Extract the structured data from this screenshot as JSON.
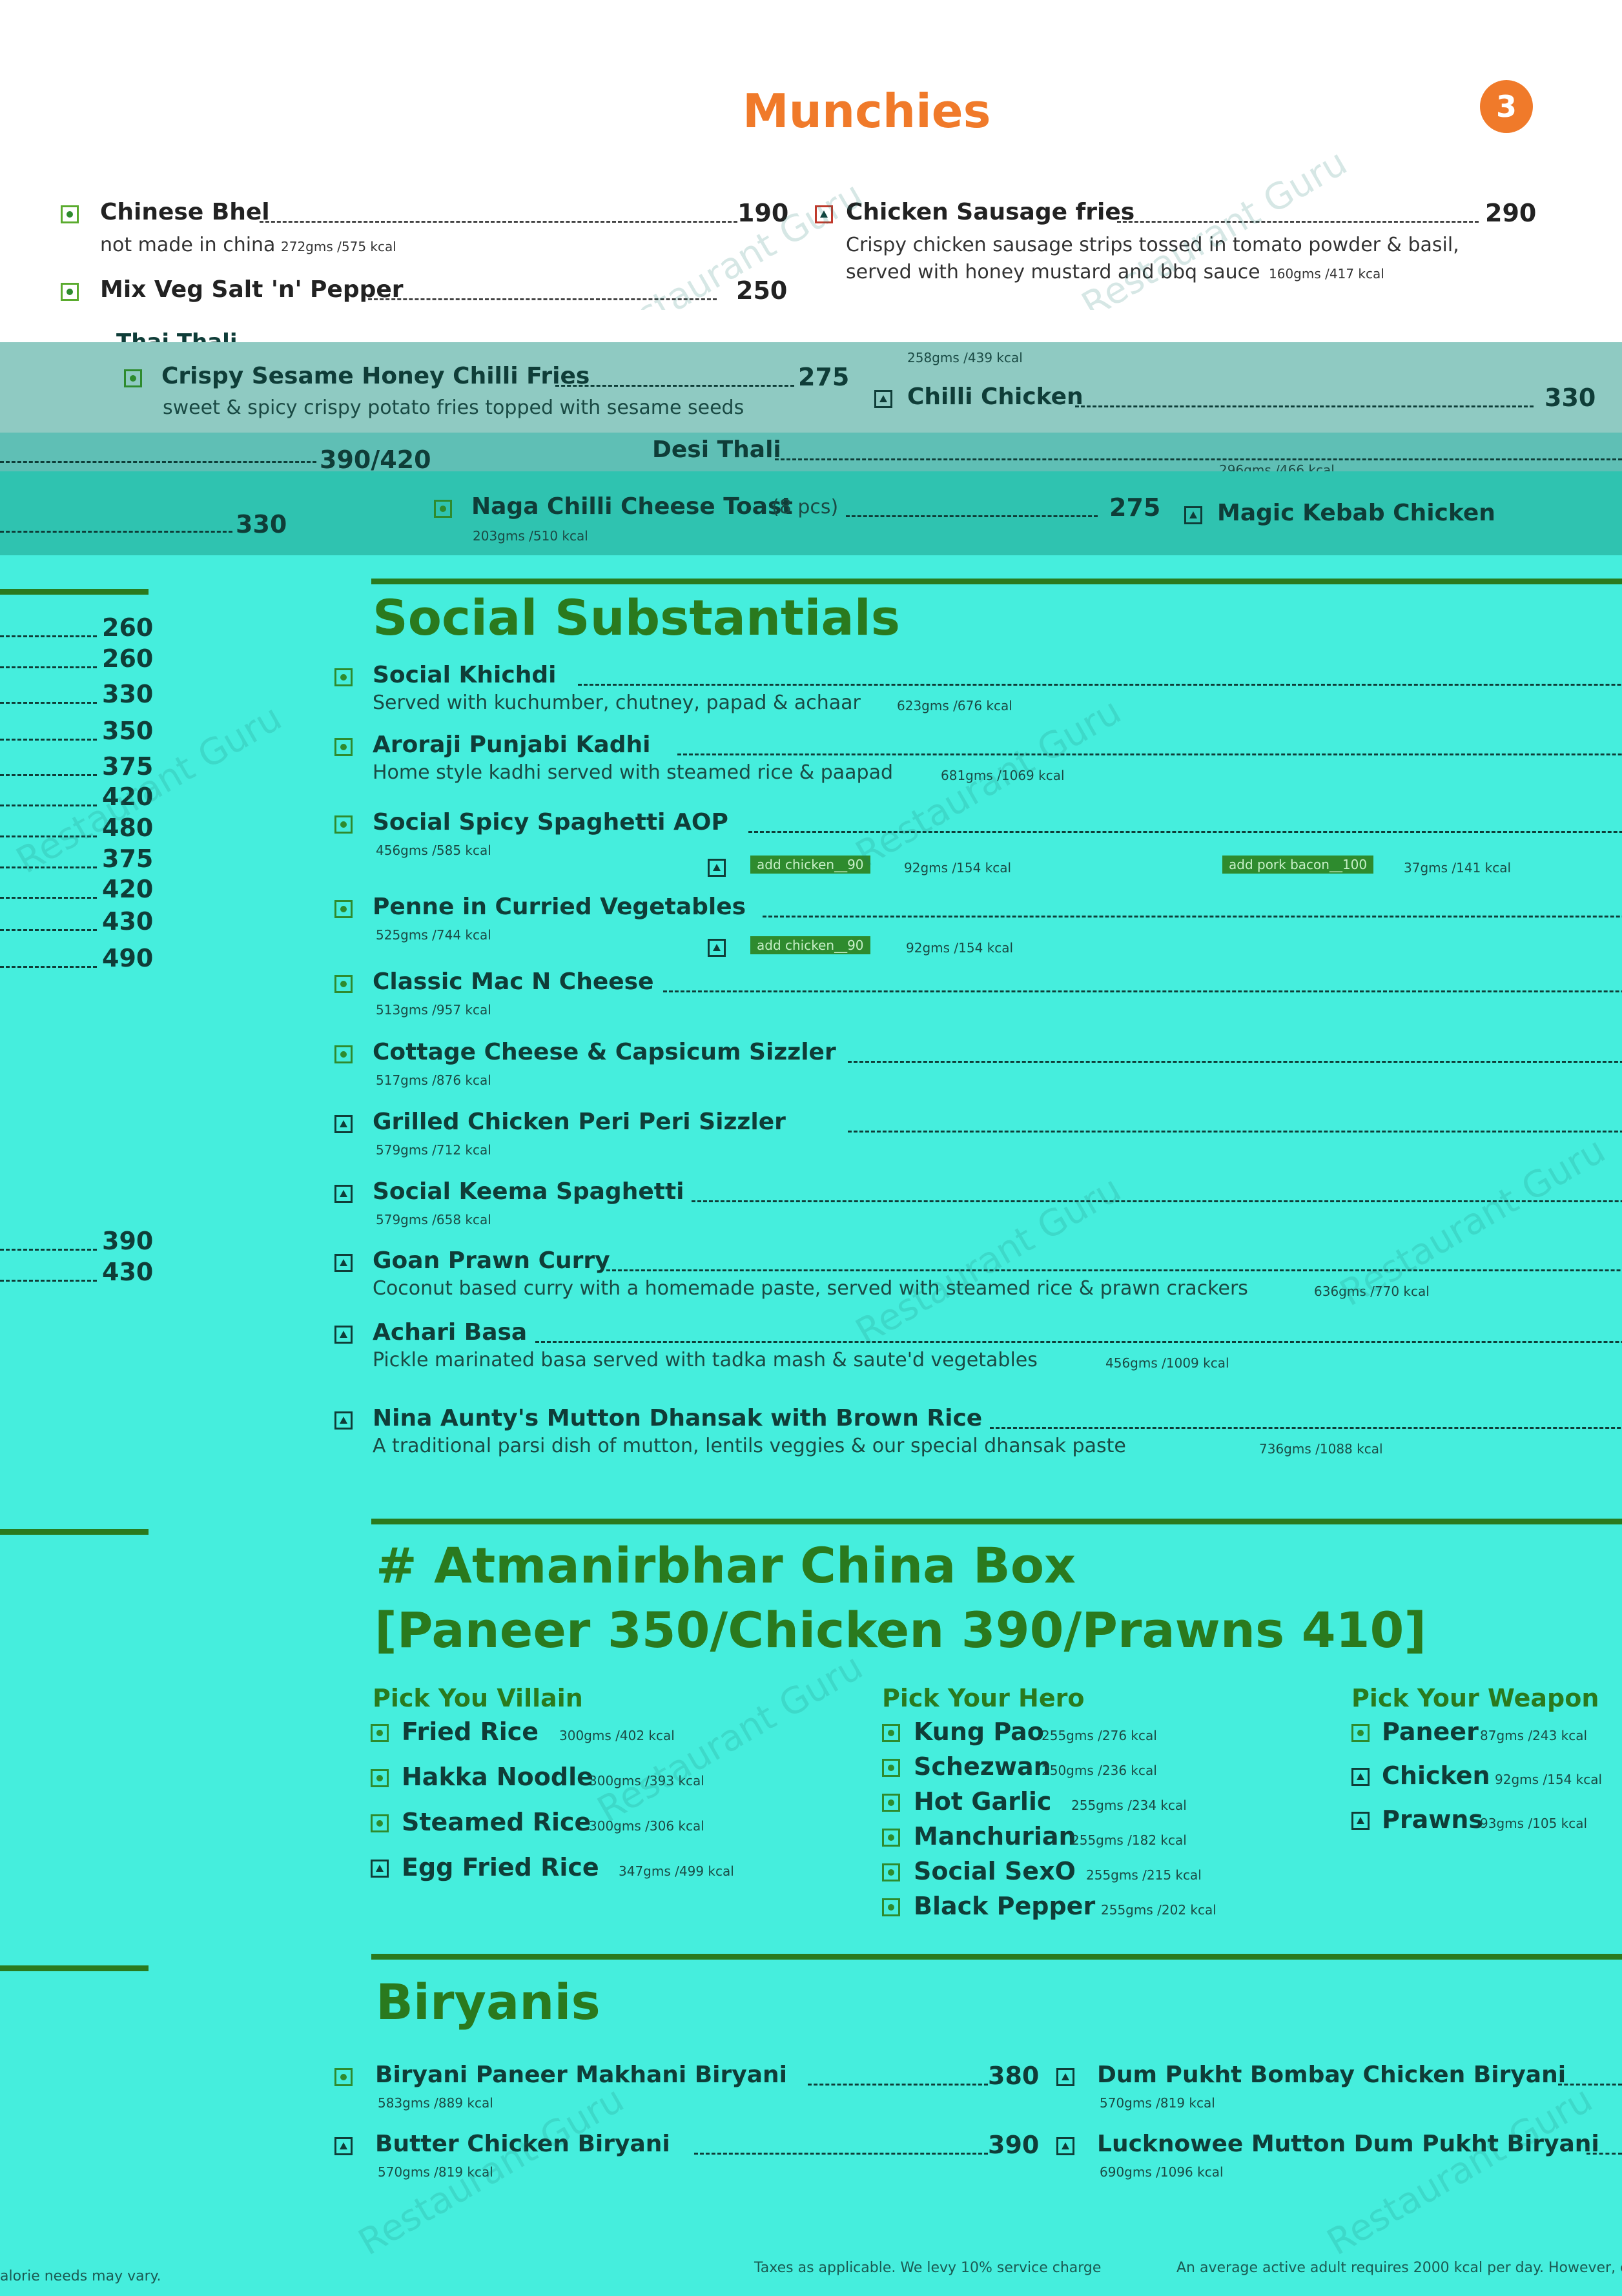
{
  "top": {
    "title": "Munchies",
    "page_badge": "3",
    "left": [
      {
        "name": "Chinese Bhel",
        "price": "190",
        "desc": "not made in china",
        "cal": "272gms /575 kcal"
      },
      {
        "name": "Mix Veg Salt 'n' Pepper",
        "price": "250"
      }
    ],
    "right": [
      {
        "name": "Chicken Sausage fries",
        "price": "290",
        "desc": "Crispy chicken sausage strips tossed in tomato powder & basil,",
        "desc2": "served with honey mustard and bbq sauce",
        "cal": "160gms /417 kcal"
      }
    ]
  },
  "scramble": {
    "thai": "Thai Thali",
    "crispy": "Crispy Sesame Honey Chilli Fries",
    "crispy_price": "275",
    "crispy_desc": "sweet & spicy crispy potato fries topped with sesame seeds",
    "cal1": "258gms /439 kcal",
    "chilli": "Chilli Chicken",
    "chilli_price": "330",
    "p390": "390/420",
    "desi": "Desi Thali",
    "cal2": "296gms /466 kcal",
    "naga": "Naga Chilli Cheese Toast",
    "naga_qty": "(8 pcs)",
    "naga_price": "275",
    "magic": "Magic Kebab Chicken",
    "p330": "330",
    "cal3": "203gms /510 kcal"
  },
  "left_prices": [
    "260",
    "260",
    "330",
    "350",
    "375",
    "420",
    "480",
    "375",
    "420",
    "430",
    "490",
    "390",
    "430"
  ],
  "social": {
    "title": "Social Substantials",
    "items": [
      {
        "name": "Social Khichdi",
        "desc": "Served with kuchumber, chutney, papad & achaar",
        "cal": "623gms /676 kcal",
        "veg": true
      },
      {
        "name": "Aroraji Punjabi Kadhi",
        "desc": "Home style kadhi served with steamed rice & paapad",
        "cal": "681gms /1069 kcal",
        "veg": true
      },
      {
        "name": "Social Spicy Spaghetti AOP",
        "cal": "456gms /585 kcal",
        "veg": true
      },
      {
        "name": "Penne in Curried Vegetables",
        "cal": "525gms /744 kcal",
        "veg": true
      },
      {
        "name": "Classic Mac N Cheese",
        "cal": "513gms /957 kcal",
        "veg": true
      },
      {
        "name": "Cottage Cheese & Capsicum Sizzler",
        "cal": "517gms /876 kcal",
        "veg": true
      },
      {
        "name": "Grilled Chicken Peri Peri Sizzler",
        "cal": "579gms /712 kcal",
        "veg": false
      },
      {
        "name": "Social Keema Spaghetti",
        "cal": "579gms /658 kcal",
        "veg": false
      },
      {
        "name": "Goan Prawn Curry",
        "desc": "Coconut based curry with a homemade paste, served with steamed rice & prawn crackers",
        "cal": "636gms /770 kcal",
        "veg": false
      },
      {
        "name": "Achari Basa",
        "desc": "Pickle marinated basa served with tadka mash & saute'd vegetables",
        "cal": "456gms /1009 kcal",
        "veg": false
      },
      {
        "name": "Nina Aunty's Mutton Dhansak with Brown Rice",
        "desc": "A traditional parsi dish of mutton, lentils veggies & our special dhansak paste",
        "cal": "736gms /1088 kcal",
        "veg": false
      }
    ],
    "addon_chicken": "add chicken__90",
    "addon_chicken_cal": "92gms /154 kcal",
    "addon_bacon": "add pork bacon__100",
    "addon_bacon_cal": "37gms /141 kcal"
  },
  "china": {
    "title": "# Atmanirbhar China Box",
    "subtitle": "[Paneer 350/Chicken 390/Prawns 410]",
    "villain_title": "Pick You Villain",
    "villain": [
      {
        "name": "Fried Rice",
        "cal": "300gms /402 kcal",
        "veg": true
      },
      {
        "name": "Hakka Noodle",
        "cal": "300gms /393 kcal",
        "veg": true
      },
      {
        "name": "Steamed Rice",
        "cal": "300gms /306 kcal",
        "veg": true
      },
      {
        "name": "Egg Fried Rice",
        "cal": "347gms /499 kcal",
        "veg": false
      }
    ],
    "hero_title": "Pick Your Hero",
    "hero": [
      {
        "name": "Kung Pao",
        "cal": "255gms /276 kcal"
      },
      {
        "name": "Schezwan",
        "cal": "250gms /236 kcal"
      },
      {
        "name": "Hot Garlic",
        "cal": "255gms /234 kcal"
      },
      {
        "name": "Manchurian",
        "cal": "255gms /182 kcal"
      },
      {
        "name": "Social SexO",
        "cal": "255gms /215 kcal"
      },
      {
        "name": "Black Pepper",
        "cal": "255gms /202 kcal"
      }
    ],
    "weapon_title": "Pick Your Weapon",
    "weapon": [
      {
        "name": "Paneer",
        "cal": "87gms /243 kcal",
        "veg": true
      },
      {
        "name": "Chicken",
        "cal": "92gms /154 kcal",
        "veg": false
      },
      {
        "name": "Prawns",
        "cal": "93gms /105 kcal",
        "veg": false
      }
    ]
  },
  "biryani": {
    "title": "Biryanis",
    "items": [
      {
        "name": "Biryani Paneer Makhani Biryani",
        "price": "380",
        "cal": "583gms /889 kcal",
        "veg": true
      },
      {
        "name": "Butter Chicken Biryani",
        "price": "390",
        "cal": "570gms /819 kcal",
        "veg": false
      },
      {
        "name": "Dum Pukht Bombay Chicken Biryani",
        "cal": "570gms /819 kcal",
        "veg": false
      },
      {
        "name": "Lucknowee Mutton Dum Pukht Biryani",
        "cal": "690gms /1096 kcal",
        "veg": false
      }
    ]
  },
  "footer": {
    "left": "alorie needs may vary.",
    "mid": "Taxes as applicable. We levy 10% service charge",
    "right": "An average active adult requires 2000 kcal per day. However, c"
  },
  "watermark": "Restaurant Guru",
  "colors": {
    "teal_bg": "#45eedd",
    "heading_green": "#2a7a1e",
    "munchies_orange": "#f07a2a",
    "badge_orange": "#f07a2a"
  }
}
